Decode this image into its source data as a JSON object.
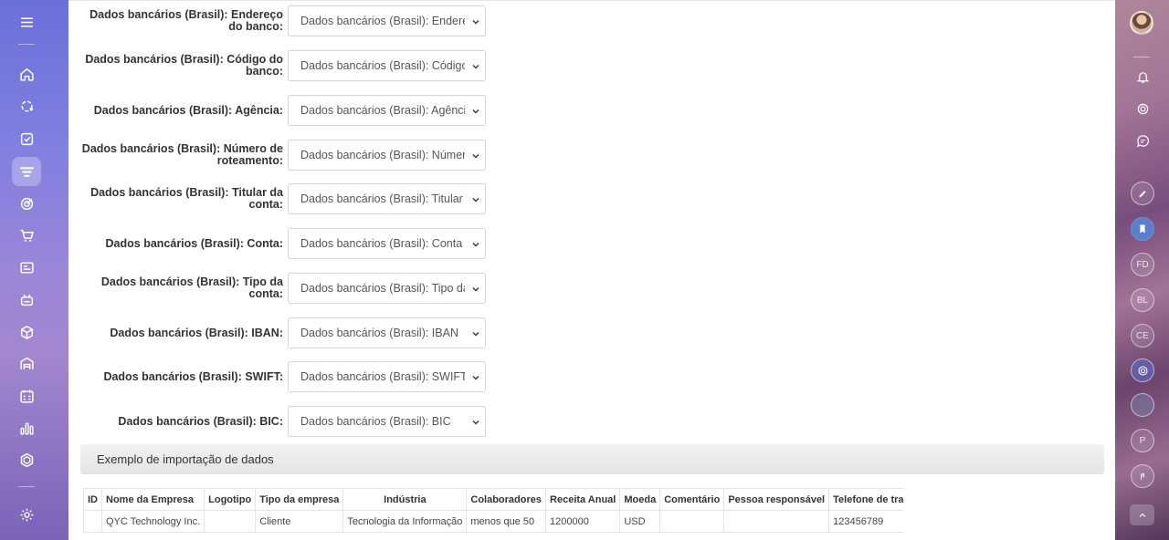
{
  "form_fields": [
    {
      "label": "Dados bancários (Brasil): Endereço do banco:",
      "value": "Dados bancários (Brasil): Endereço"
    },
    {
      "label": "Dados bancários (Brasil): Código do banco:",
      "value": "Dados bancários (Brasil): Código de"
    },
    {
      "label": "Dados bancários (Brasil): Agência:",
      "value": "Dados bancários (Brasil): Agência"
    },
    {
      "label": "Dados bancários (Brasil): Número de roteamento:",
      "value": "Dados bancários (Brasil): Número d"
    },
    {
      "label": "Dados bancários (Brasil): Titular da conta:",
      "value": "Dados bancários (Brasil): Titular da"
    },
    {
      "label": "Dados bancários (Brasil): Conta:",
      "value": "Dados bancários (Brasil): Conta"
    },
    {
      "label": "Dados bancários (Brasil): Tipo da conta:",
      "value": "Dados bancários (Brasil): Tipo da co"
    },
    {
      "label": "Dados bancários (Brasil): IBAN:",
      "value": "Dados bancários (Brasil): IBAN"
    },
    {
      "label": "Dados bancários (Brasil): SWIFT:",
      "value": "Dados bancários (Brasil): SWIFT"
    },
    {
      "label": "Dados bancários (Brasil): BIC:",
      "value": "Dados bancários (Brasil): BIC"
    }
  ],
  "example_section": {
    "title": "Exemplo de importação de dados",
    "columns": [
      "ID",
      "Nome da Empresa",
      "Logotipo",
      "Tipo da empresa",
      "Indústria",
      "Colaboradores",
      "Receita Anual",
      "Moeda",
      "Comentário",
      "Pessoa responsável",
      "Telefone de trabalho"
    ],
    "rows": [
      [
        "",
        "QYC Technology Inc.",
        "",
        "Cliente",
        "Tecnologia da Informação",
        "menos que 50",
        "1200000",
        "USD",
        "",
        "",
        "123456789"
      ]
    ]
  },
  "left_sidebar": {
    "icons": [
      "menu-icon",
      "home-icon",
      "crm-icon",
      "tasks-icon",
      "filter-icon",
      "target-icon",
      "cart-icon",
      "contact-card-icon",
      "robot-icon",
      "box-icon",
      "warehouse-icon",
      "calendar-icon",
      "chart-icon",
      "hexagon-icon",
      "settings-icon"
    ],
    "active": "filter-icon"
  },
  "right_sidebar": {
    "items": [
      "avatar",
      "bell-icon",
      "spiral-icon",
      "chat-icon",
      "pen-icon",
      "bookmark-icon",
      "FD",
      "BL",
      "CE",
      "spiral-active-icon",
      "blank",
      "P",
      "hand-icon",
      "chevron-up-icon"
    ],
    "initials": {
      "fd": "FD",
      "bl": "BL",
      "ce": "CE",
      "p": "P"
    }
  },
  "colors": {
    "sidebar_left": "#7d7fe0",
    "accent": "#5a7fcc",
    "section_bar": "#e8e8e8"
  }
}
